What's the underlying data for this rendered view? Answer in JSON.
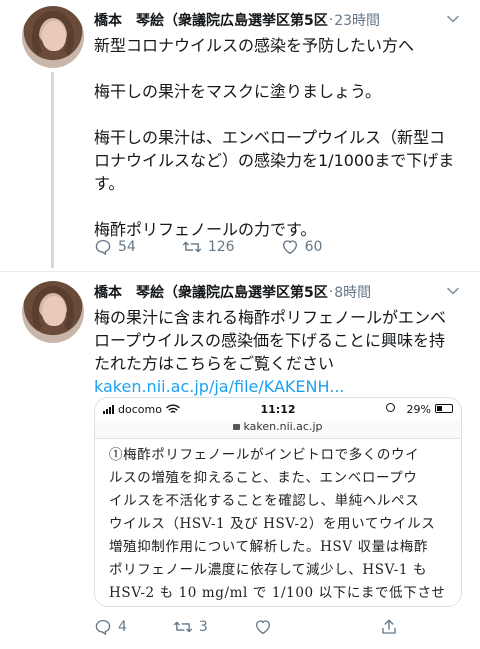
{
  "tweets": [
    {
      "name": "橋本　琴絵（衆議院広島選挙区第5区",
      "separator": "·",
      "time": "23時間",
      "body": [
        "新型コロナウイルスの感染を予防したい方へ",
        "",
        "梅干しの果汁をマスクに塗りましょう。",
        "",
        "梅干しの果汁は、エンベロープウイルス（新型コ",
        "ロナウイルスなど）の感染力を1/1000まで下げま",
        "す。",
        "",
        "梅酢ポリフェノールの力です。"
      ],
      "replies": "54",
      "retweets": "126",
      "likes": "60"
    },
    {
      "name": "橋本　琴絵（衆議院広島選挙区第5区",
      "separator": "·",
      "time": "8時間",
      "body": [
        "梅の果汁に含まれる梅酢ポリフェノールがエンベ",
        "ロープウイルスの感染価を下げることに興味を持",
        "たれた方はこちらをご覧ください"
      ],
      "link": "kaken.nii.ac.jp/ja/file/KAKENH...",
      "replies": "4",
      "retweets": "3",
      "likes": ""
    }
  ],
  "card": {
    "carrier": "docomo",
    "clock": "11:12",
    "battery": "29%",
    "url": "kaken.nii.ac.jp",
    "doc_lines": [
      "①梅酢ポリフェノールがインビトロで多くのウイ",
      "ルスの増殖を抑えること、また、エンベロープウ",
      "イルスを不活化することを確認し、単純ヘルペス",
      "ウイルス（HSV-1 及び HSV-2）を用いてウイルス",
      "増殖抑制作用について解析した。HSV 収量は梅酢",
      "ポリフェノール濃度に依存して減少し、HSV-1 も",
      "HSV-2 も 10 mg/ml で 1/100 以下にまで低下させ"
    ]
  },
  "icons": {
    "reply": "reply-icon",
    "retweet": "retweet-icon",
    "like": "heart-icon",
    "share": "share-icon",
    "caret": "chevron-down-icon"
  },
  "colors": {
    "link": "#1da1f2",
    "muted": "#657786",
    "thread_line": "#cfd9de"
  }
}
